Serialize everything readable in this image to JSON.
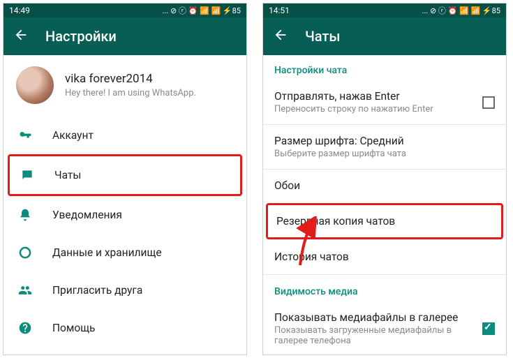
{
  "left": {
    "status_time": "14:49",
    "status_icons": "...  ⊘ ⓡ ⏰ 📶 📶 ⚡85",
    "header_title": "Настройки",
    "profile_name": "vika forever2014",
    "profile_status": "Hey there! I am using WhatsApp.",
    "items": {
      "account": "Аккаунт",
      "chats": "Чаты",
      "notifications": "Уведомления",
      "data": "Данные и хранилище",
      "invite": "Пригласить друга",
      "help": "Помощь"
    }
  },
  "right": {
    "status_time": "14:51",
    "status_icons": "...  ⊘ ⓡ ⏰ 📶 📶 ⚡85",
    "header_title": "Чаты",
    "section_chat_settings": "Настройки чата",
    "enter_send_title": "Отправлять, нажав Enter",
    "enter_send_sub": "Переносить строку по нажатию Enter",
    "font_title": "Размер шрифта: Средний",
    "font_sub": "Выберите размер шрифта чата",
    "wallpaper": "Обои",
    "backup": "Резервная копия чатов",
    "history": "История чатов",
    "section_media": "Видимость медиа",
    "media_title": "Показывать медиафайлы в галерее",
    "media_sub": "Показывать загруженные медиафайлы в галерее телефона"
  }
}
